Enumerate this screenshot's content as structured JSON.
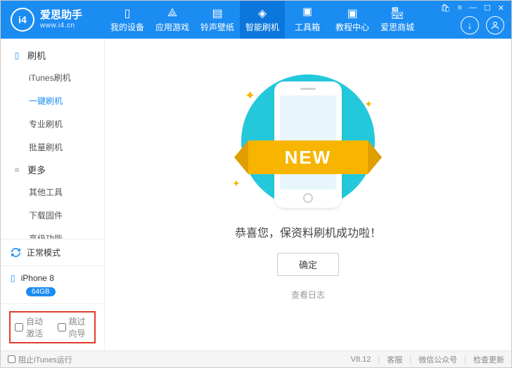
{
  "app": {
    "name_cn": "爱思助手",
    "name_en": "www.i4.cn",
    "logo_letters": "i4"
  },
  "nav": [
    {
      "label": "我的设备"
    },
    {
      "label": "应用游戏"
    },
    {
      "label": "铃声壁纸"
    },
    {
      "label": "智能刷机",
      "active": true
    },
    {
      "label": "工具箱"
    },
    {
      "label": "教程中心"
    },
    {
      "label": "爱思商城"
    }
  ],
  "sidebar": {
    "group1": {
      "title": "刷机",
      "items": [
        {
          "label": "iTunes刷机"
        },
        {
          "label": "一键刷机",
          "active": true
        },
        {
          "label": "专业刷机"
        },
        {
          "label": "批量刷机"
        }
      ]
    },
    "group2": {
      "title": "更多",
      "items": [
        {
          "label": "其他工具"
        },
        {
          "label": "下载固件"
        },
        {
          "label": "高级功能"
        }
      ]
    },
    "status": "正常模式",
    "device": {
      "name": "iPhone 8",
      "storage": "64GB"
    },
    "checks": {
      "auto_activate": "自动激活",
      "skip_wizard": "跳过向导"
    }
  },
  "content": {
    "ribbon": "NEW",
    "message": "恭喜您，保资料刷机成功啦！",
    "confirm": "确定",
    "view_log": "查看日志"
  },
  "footer": {
    "block_itunes": "阻止iTunes运行",
    "version": "V8.12",
    "support": "客服",
    "wechat": "微信公众号",
    "update": "检查更新"
  }
}
